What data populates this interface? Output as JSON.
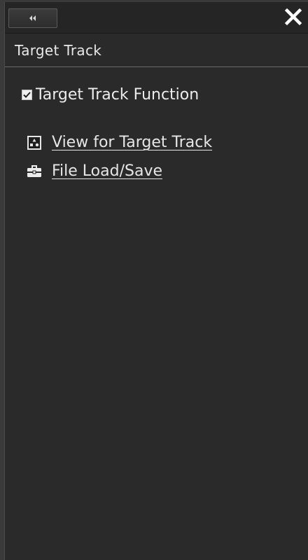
{
  "header": {
    "collapse_icon": "double-chevron-left-icon",
    "close_icon": "close-x-icon"
  },
  "panel": {
    "title": "Target Track"
  },
  "function_toggle": {
    "label": "Target Track Function",
    "checked": true
  },
  "links": [
    {
      "label": "View for Target Track",
      "icon": "target-view-icon"
    },
    {
      "label": "File Load/Save",
      "icon": "toolbox-icon"
    }
  ],
  "colors": {
    "panel_bg": "#2b2a2b",
    "text": "#e8e8e8",
    "divider": "#6a6a6a"
  }
}
